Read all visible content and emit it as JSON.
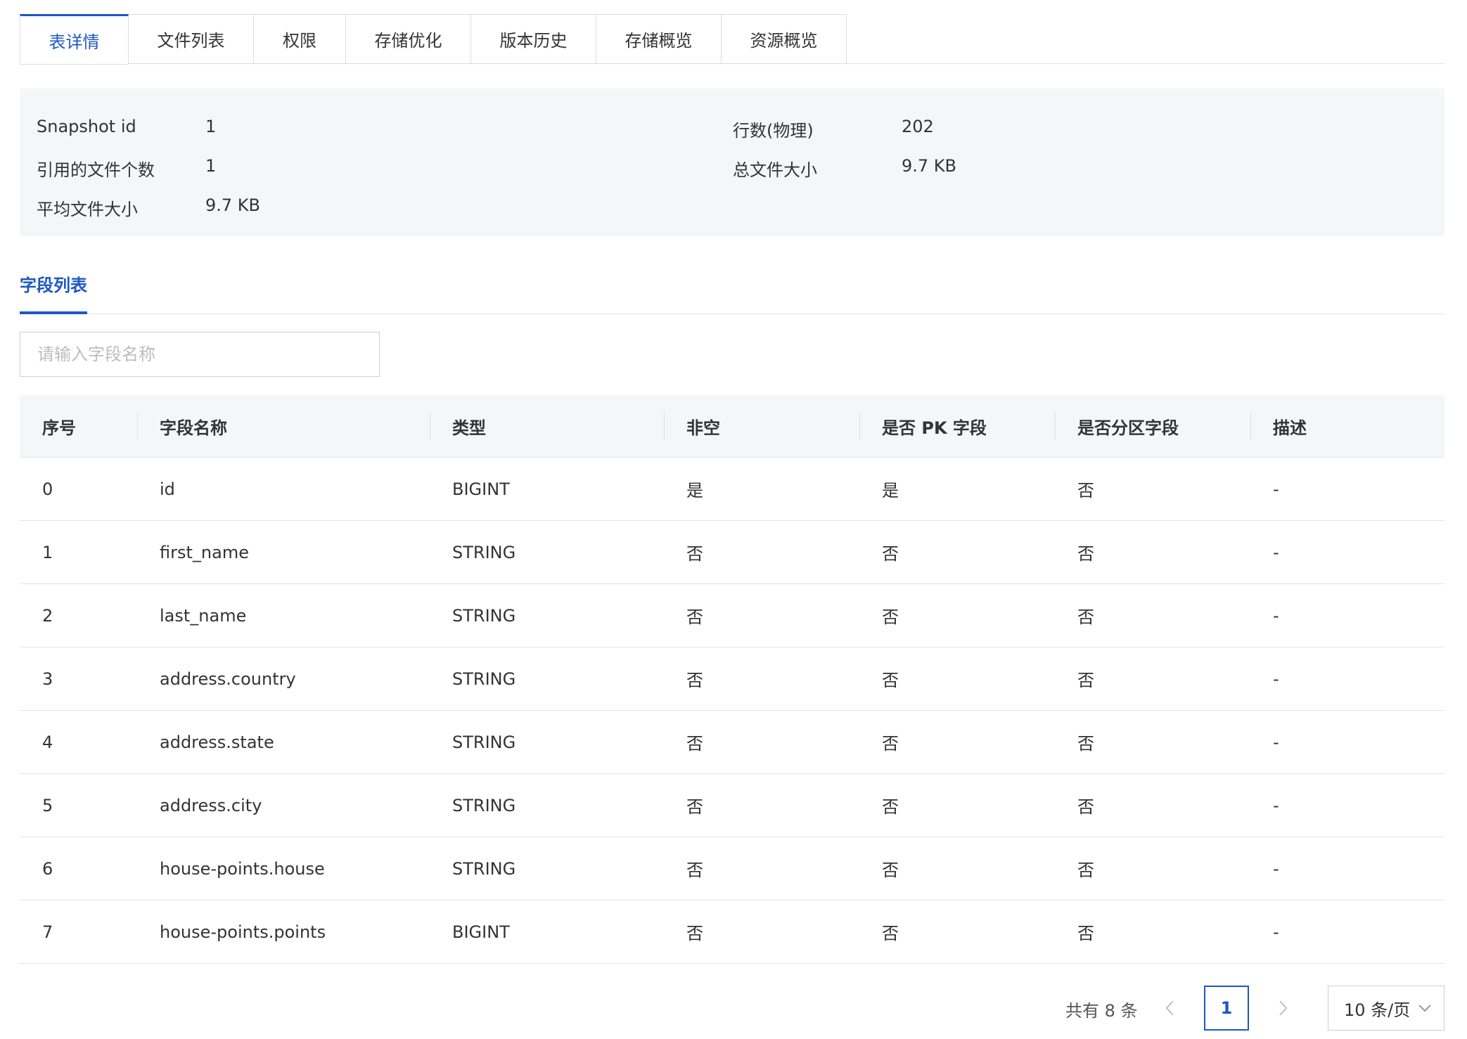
{
  "tabs": [
    "表详情",
    "文件列表",
    "权限",
    "存储优化",
    "版本历史",
    "存储概览",
    "资源概览"
  ],
  "info": {
    "snapshot_label": "Snapshot id",
    "snapshot_value": "1",
    "rows_label": "行数(物理)",
    "rows_value": "202",
    "ref_files_label": "引用的文件个数",
    "ref_files_value": "1",
    "total_size_label": "总文件大小",
    "total_size_value": "9.7 KB",
    "avg_size_label": "平均文件大小",
    "avg_size_value": "9.7 KB"
  },
  "fields_section": {
    "title": "字段列表",
    "search_placeholder": "请输入字段名称"
  },
  "table": {
    "headers": [
      "序号",
      "字段名称",
      "类型",
      "非空",
      "是否 PK 字段",
      "是否分区字段",
      "描述"
    ],
    "rows": [
      [
        "0",
        "id",
        "BIGINT",
        "是",
        "是",
        "否",
        "-"
      ],
      [
        "1",
        "first_name",
        "STRING",
        "否",
        "否",
        "否",
        "-"
      ],
      [
        "2",
        "last_name",
        "STRING",
        "否",
        "否",
        "否",
        "-"
      ],
      [
        "3",
        "address.country",
        "STRING",
        "否",
        "否",
        "否",
        "-"
      ],
      [
        "4",
        "address.state",
        "STRING",
        "否",
        "否",
        "否",
        "-"
      ],
      [
        "5",
        "address.city",
        "STRING",
        "否",
        "否",
        "否",
        "-"
      ],
      [
        "6",
        "house-points.house",
        "STRING",
        "否",
        "否",
        "否",
        "-"
      ],
      [
        "7",
        "house-points.points",
        "BIGINT",
        "否",
        "否",
        "否",
        "-"
      ]
    ]
  },
  "pagination": {
    "total_text": "共有 8 条",
    "current_page": "1",
    "page_size": "10 条/页"
  },
  "icons": {
    "prev": "chevron-left-icon",
    "next": "chevron-right-icon",
    "dropdown": "chevron-down-icon"
  },
  "colors": {
    "accent": "#1b58c4",
    "panel_bg": "#f5f6f7"
  }
}
